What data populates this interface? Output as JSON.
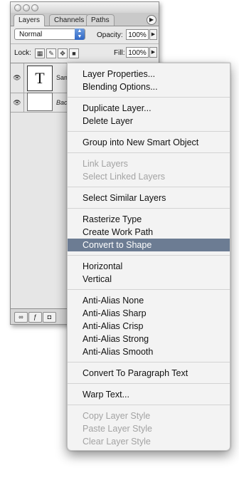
{
  "palette": {
    "tabs": [
      "Layers",
      "Channels",
      "Paths"
    ],
    "blend_mode": "Normal",
    "opacity_label": "Opacity:",
    "opacity_value": "100%",
    "lock_label": "Lock:",
    "fill_label": "Fill:",
    "fill_value": "100%",
    "layers": [
      {
        "name": "Sam",
        "thumbnail_text": "T",
        "type": "text"
      },
      {
        "name": "Background",
        "type": "image"
      }
    ]
  },
  "menu": {
    "groups": [
      [
        "Layer Properties...",
        "Blending Options..."
      ],
      [
        "Duplicate Layer...",
        "Delete Layer"
      ],
      [
        "Group into New Smart Object"
      ],
      [
        "Link Layers",
        "Select Linked Layers"
      ],
      [
        "Select Similar Layers"
      ],
      [
        "Rasterize Type",
        "Create Work Path",
        "Convert to Shape"
      ],
      [
        "Horizontal",
        "Vertical"
      ],
      [
        "Anti-Alias None",
        "Anti-Alias Sharp",
        "Anti-Alias Crisp",
        "Anti-Alias Strong",
        "Anti-Alias Smooth"
      ],
      [
        "Convert To Paragraph Text"
      ],
      [
        "Warp Text..."
      ],
      [
        "Copy Layer Style",
        "Paste Layer Style",
        "Clear Layer Style"
      ]
    ],
    "selected_item": "Convert to Shape",
    "disabled_items": [
      "Link Layers",
      "Select Linked Layers",
      "Copy Layer Style",
      "Paste Layer Style",
      "Clear Layer Style"
    ]
  }
}
